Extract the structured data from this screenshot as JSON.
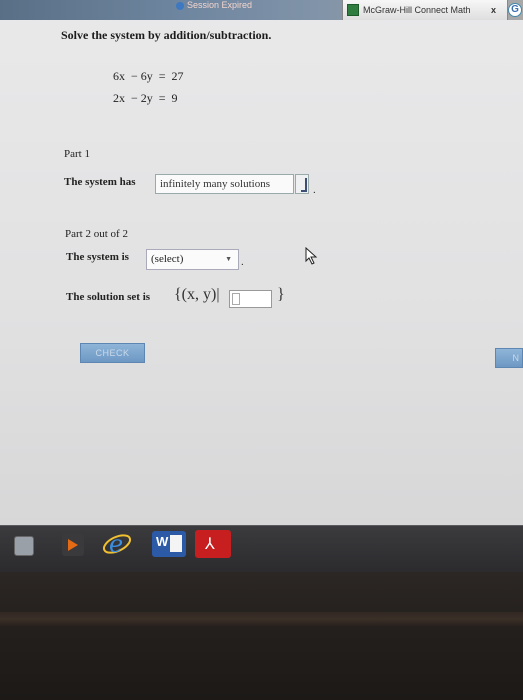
{
  "browser": {
    "session_text": "Session Expired",
    "tab_title": "McGraw-Hill Connect Math",
    "tab_close": "x",
    "extra_tab_icon": "G"
  },
  "question": {
    "heading": "Solve the system by addition/subtraction.",
    "equations": [
      "6x  − 6y  =  27",
      "2x  − 2y  =  9"
    ]
  },
  "part1": {
    "label": "Part 1",
    "text": "The system has",
    "selected_value": "infinitely many solutions",
    "punct": "."
  },
  "part2": {
    "label": "Part 2 out of 2",
    "text": "The system is",
    "select_value": "(select)",
    "punct": ".",
    "solution_label": "The solution set is",
    "solution_open": "{(x, y)|",
    "solution_close": "}",
    "solution_value": ""
  },
  "buttons": {
    "check": "CHECK",
    "next": "N"
  },
  "taskbar": {
    "icons": [
      "window-thumbnail-icon",
      "media-player-icon",
      "internet-explorer-icon",
      "word-icon",
      "acrobat-icon"
    ]
  },
  "colors": {
    "button_blue": "#7aa3cd",
    "page_bg": "#e5e5e6",
    "taskbar": "#333336"
  }
}
